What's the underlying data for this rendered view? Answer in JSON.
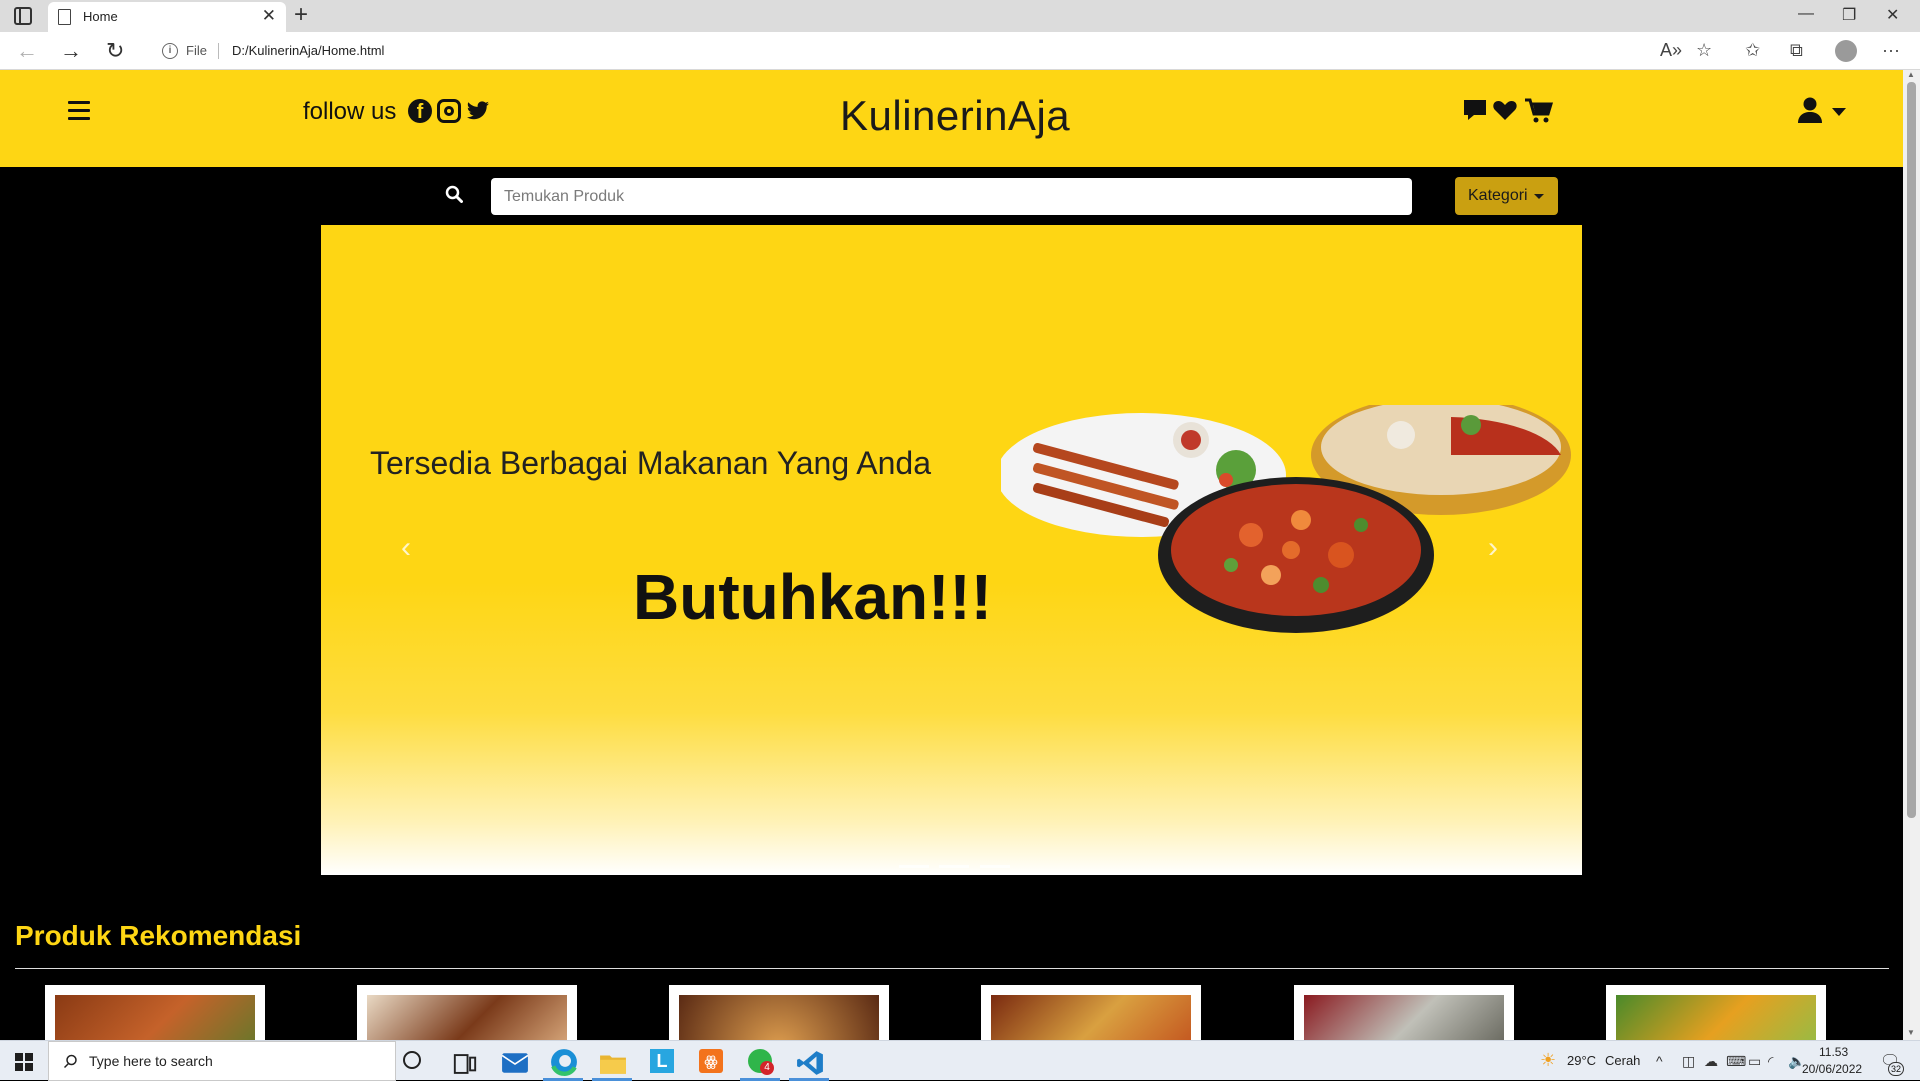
{
  "browser": {
    "tab_title": "Home",
    "tab_close": "✕",
    "new_tab": "+",
    "address_scheme": "File",
    "address_url": "D:/KulinerinAja/Home.html",
    "window_controls": [
      "—",
      "❐",
      "✕"
    ],
    "more_menu": "···"
  },
  "header": {
    "follow_text": "follow us",
    "brand": "KulinerinAja",
    "social_icons": [
      "facebook-icon",
      "instagram-icon",
      "twitter-icon"
    ],
    "action_icons": [
      "chat-icon",
      "heart-icon",
      "cart-icon",
      "user-icon"
    ],
    "bg_color": "#fed614"
  },
  "search": {
    "placeholder": "Temukan Produk",
    "category_button": "Kategori"
  },
  "carousel": {
    "line1": "Tersedia Berbagai Makanan Yang Anda",
    "line2": "Butuhkan!!!",
    "prev": "‹",
    "next": "›"
  },
  "recommendations": {
    "title": "Produk Rekomendasi",
    "title_color": "#fed614"
  },
  "taskbar": {
    "search_placeholder": "Type here to search",
    "weather_temp": "29°C",
    "weather_desc": "Cerah",
    "time": "11.53",
    "date": "20/06/2022",
    "notification_count": "32",
    "whatsapp_badge": "4"
  }
}
